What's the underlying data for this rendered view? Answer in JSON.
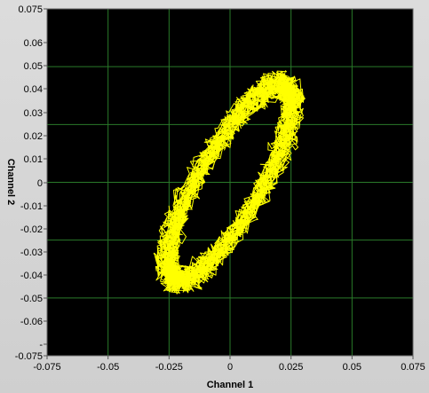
{
  "chart_data": {
    "type": "scatter",
    "title": "",
    "xlabel": "Channel 1",
    "ylabel": "Channel 2",
    "xlim": [
      -0.075,
      0.075
    ],
    "ylim": [
      -0.075,
      0.075
    ],
    "grid": true,
    "x_ticks": [
      "-0.075",
      "-0.05",
      "-0.025",
      "0",
      "0.025",
      "0.05",
      "0.075"
    ],
    "y_ticks": [
      "0.075",
      "0.06",
      "0.05",
      "0.04",
      "0.03",
      "0.02",
      "0.01",
      "0",
      "-0.01",
      "-0.02",
      "-0.03",
      "-0.04",
      "-0.05",
      "-0.06",
      "-",
      "-0.075"
    ],
    "series": [
      {
        "color": "#ffff00",
        "center": [
          0.0,
          0.0
        ],
        "extent_x": [
          -0.029,
          0.029
        ],
        "extent_y": [
          -0.049,
          0.047
        ]
      }
    ],
    "colors": {
      "plot_bg": "#000000",
      "grid": "#2a7a2a",
      "trace": "#ffff00"
    }
  }
}
